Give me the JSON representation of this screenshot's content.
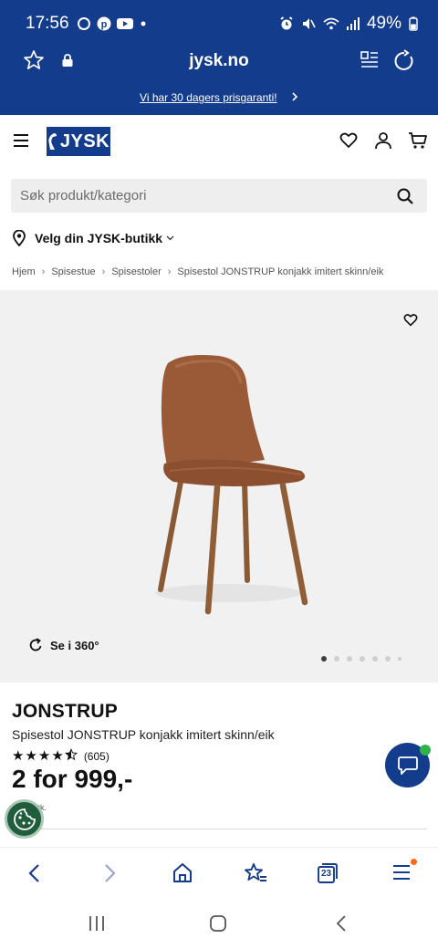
{
  "status_bar": {
    "time": "17:56",
    "battery": "49%",
    "left_icons": [
      "whatsapp-icon",
      "pinterest-icon",
      "youtube-icon",
      "dot-icon"
    ],
    "right_icons": [
      "alarm-icon",
      "mute-icon",
      "wifi-icon",
      "signal-icon",
      "battery-icon"
    ]
  },
  "browser": {
    "url": "jysk.no",
    "promo_text": "Vi har 30 dagers prisgaranti!"
  },
  "header": {
    "logo_text": "JYSK"
  },
  "search": {
    "placeholder": "Søk produkt/kategori"
  },
  "store_selector": {
    "label": "Velg din JYSK-butikk"
  },
  "breadcrumb": [
    "Hjem",
    "Spisestue",
    "Spisestoler",
    "Spisestol JONSTRUP konjakk imitert skinn/eik"
  ],
  "gallery": {
    "view360_label": "Se i 360°",
    "image_count": 7,
    "active_index": 0
  },
  "product": {
    "name": "JONSTRUP",
    "description": "Spisestol JONSTRUP konjakk imitert skinn/eik",
    "rating": 4.5,
    "review_count": "(605)",
    "price": "2 for 999,-",
    "unit_note": "stk."
  },
  "colors": {
    "brand_blue": "#143c8c",
    "chat_online": "#2db34a",
    "cookie_green": "#1f5d3c",
    "badge_orange": "#ff6a1a"
  },
  "bottom_toolbar": {
    "tabs_count": "23"
  }
}
